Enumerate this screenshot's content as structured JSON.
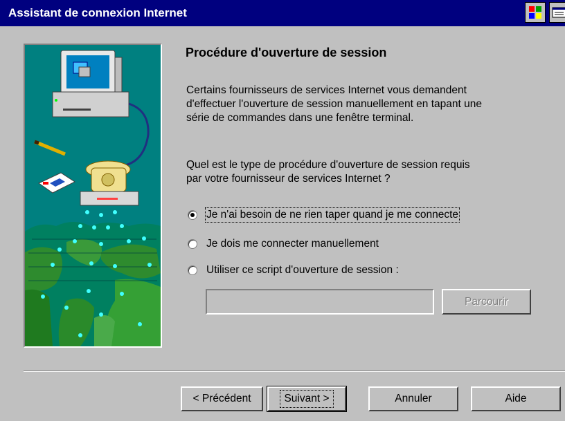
{
  "window": {
    "title": "Assistant de connexion Internet"
  },
  "content": {
    "heading": "Procédure d'ouverture de session",
    "paragraph1": [
      "Certains fournisseurs de services Internet vous demandent",
      "d'effectuer l'ouverture de session manuellement en tapant une",
      "série de commandes dans une fenêtre terminal."
    ],
    "paragraph2": [
      "Quel est le type de procédure d'ouverture de session requis",
      "par votre fournisseur de services Internet ?"
    ],
    "options": [
      {
        "label": "Je n'ai besoin de ne rien taper quand je me connecte",
        "selected": true
      },
      {
        "label": "Je dois me connecter manuellement",
        "selected": false
      },
      {
        "label": "Utiliser ce script d'ouverture de session :",
        "selected": false
      }
    ],
    "script_field": {
      "value": ""
    },
    "browse_label": "Parcourir"
  },
  "footer": {
    "back_label": "< Précédent",
    "next_label": "Suivant >",
    "cancel_label": "Annuler",
    "help_label": "Aide"
  },
  "colors": {
    "titlebar": "#00007f",
    "face": "#c0c0c0",
    "picture_bg": "#008080"
  }
}
